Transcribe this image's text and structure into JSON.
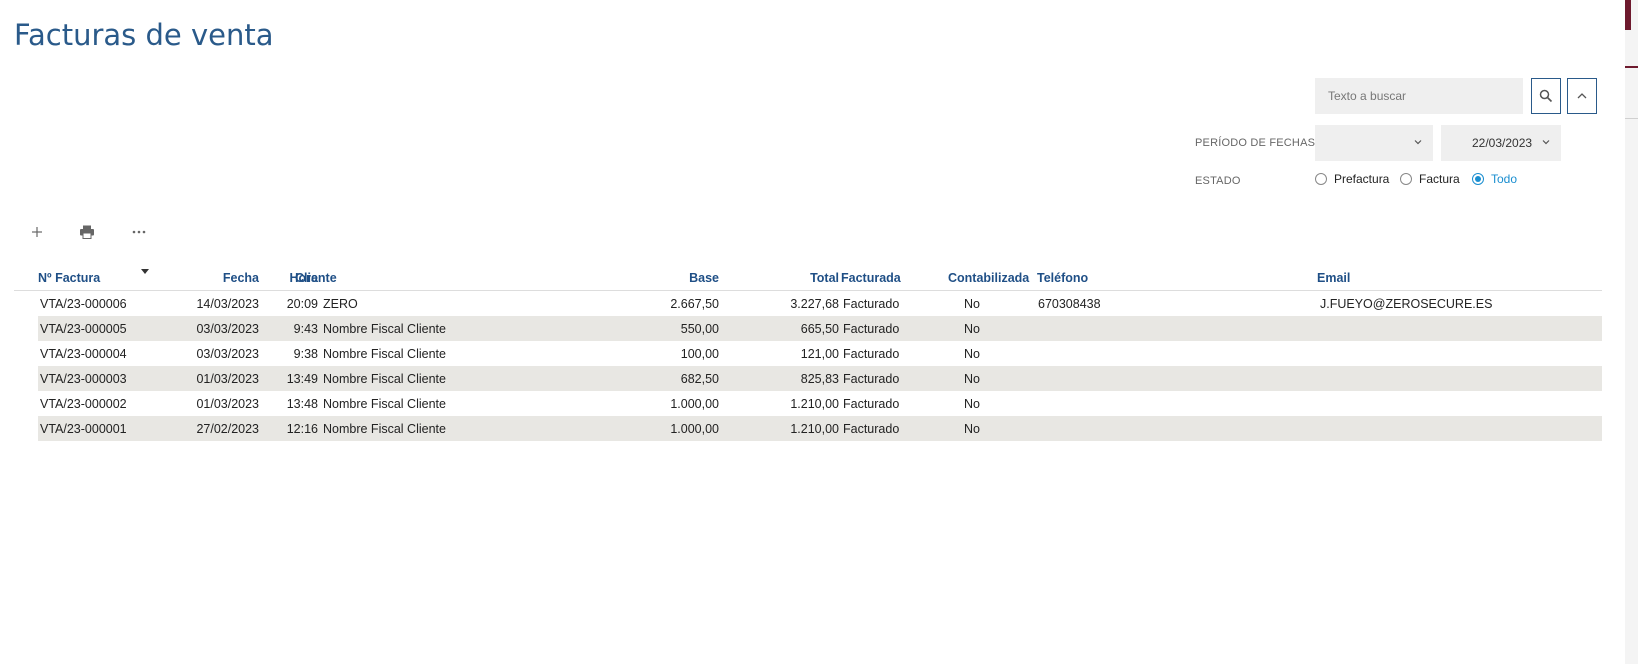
{
  "page": {
    "title": "Facturas de venta"
  },
  "search": {
    "placeholder": "Texto a buscar"
  },
  "filters": {
    "period_label": "PERÍODO DE FECHAS",
    "period_value": "",
    "date_value": "22/03/2023",
    "state_label": "ESTADO",
    "states": [
      {
        "label": "Prefactura",
        "checked": false
      },
      {
        "label": "Factura",
        "checked": false
      },
      {
        "label": "Todo",
        "checked": true
      }
    ]
  },
  "toolbar": {
    "icons": [
      "plus-icon",
      "printer-icon",
      "more-icon"
    ]
  },
  "table": {
    "columns": [
      "Nº Factura",
      "Fecha",
      "Hora",
      "Cliente",
      "Base",
      "Total",
      "Facturada",
      "Contabilizada",
      "Teléfono",
      "Email"
    ],
    "rows": [
      {
        "num": "VTA/23-000006",
        "fecha": "14/03/2023",
        "hora": "20:09",
        "cliente": "ZERO",
        "base": "2.667,50",
        "total": "3.227,68",
        "facturada": "Facturado",
        "contabilizada": "No",
        "telefono": "670308438",
        "email": "J.FUEYO@ZEROSECURE.ES"
      },
      {
        "num": "VTA/23-000005",
        "fecha": "03/03/2023",
        "hora": "9:43",
        "cliente": "Nombre Fiscal Cliente",
        "base": "550,00",
        "total": "665,50",
        "facturada": "Facturado",
        "contabilizada": "No",
        "telefono": "",
        "email": ""
      },
      {
        "num": "VTA/23-000004",
        "fecha": "03/03/2023",
        "hora": "9:38",
        "cliente": "Nombre Fiscal Cliente",
        "base": "100,00",
        "total": "121,00",
        "facturada": "Facturado",
        "contabilizada": "No",
        "telefono": "",
        "email": ""
      },
      {
        "num": "VTA/23-000003",
        "fecha": "01/03/2023",
        "hora": "13:49",
        "cliente": "Nombre Fiscal Cliente",
        "base": "682,50",
        "total": "825,83",
        "facturada": "Facturado",
        "contabilizada": "No",
        "telefono": "",
        "email": ""
      },
      {
        "num": "VTA/23-000002",
        "fecha": "01/03/2023",
        "hora": "13:48",
        "cliente": "Nombre Fiscal Cliente",
        "base": "1.000,00",
        "total": "1.210,00",
        "facturada": "Facturado",
        "contabilizada": "No",
        "telefono": "",
        "email": ""
      },
      {
        "num": "VTA/23-000001",
        "fecha": "27/02/2023",
        "hora": "12:16",
        "cliente": "Nombre Fiscal Cliente",
        "base": "1.000,00",
        "total": "1.210,00",
        "facturada": "Facturado",
        "contabilizada": "No",
        "telefono": "",
        "email": ""
      }
    ]
  }
}
